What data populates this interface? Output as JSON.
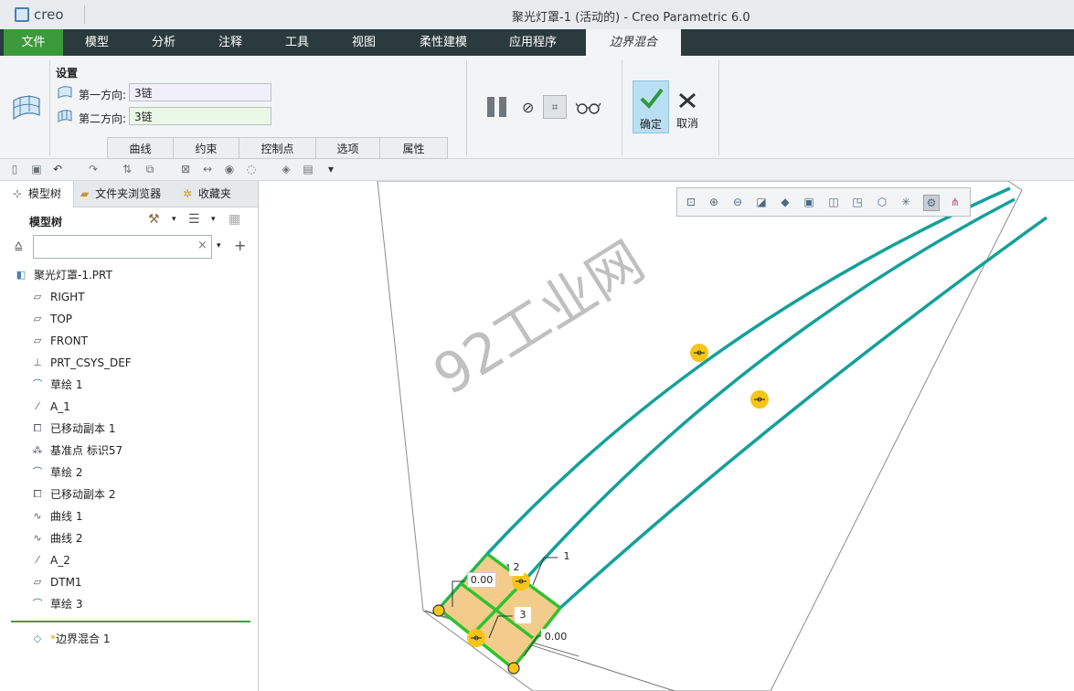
{
  "window": {
    "app_name": "creo",
    "title": "聚光灯罩-1 (活动的) - Creo Parametric 6.0"
  },
  "menu": {
    "file": "文件",
    "tabs": [
      "模型",
      "分析",
      "注释",
      "工具",
      "视图",
      "柔性建模",
      "应用程序"
    ],
    "active_tab": "边界混合"
  },
  "ribbon": {
    "settings_label": "设置",
    "first_direction_label": "第一方向:",
    "first_direction_value": "3链",
    "second_direction_label": "第二方向:",
    "second_direction_value": "3链",
    "subtabs": [
      "曲线",
      "约束",
      "控制点",
      "选项",
      "属性"
    ],
    "ok_label": "确定",
    "cancel_label": "取消",
    "colors": {
      "first_input_bg": "#f1effc",
      "second_input_bg": "#eaf8e6",
      "ok_bg": "#b9dff2"
    }
  },
  "nav": {
    "tabs": [
      "模型树",
      "文件夹浏览器",
      "收藏夹"
    ],
    "header": "模型树",
    "search_placeholder": "",
    "root": "聚光灯罩-1.PRT",
    "items": [
      {
        "label": "RIGHT",
        "icon": "datum-plane-icon"
      },
      {
        "label": "TOP",
        "icon": "datum-plane-icon"
      },
      {
        "label": "FRONT",
        "icon": "datum-plane-icon"
      },
      {
        "label": "PRT_CSYS_DEF",
        "icon": "csys-icon"
      },
      {
        "label": "草绘 1",
        "icon": "sketch-icon"
      },
      {
        "label": "A_1",
        "icon": "axis-icon"
      },
      {
        "label": "已移动副本 1",
        "icon": "moved-copy-icon"
      },
      {
        "label": "基准点 标识57",
        "icon": "datum-point-icon"
      },
      {
        "label": "草绘 2",
        "icon": "sketch-icon"
      },
      {
        "label": "已移动副本 2",
        "icon": "moved-copy-icon"
      },
      {
        "label": "曲线 1",
        "icon": "curve-icon"
      },
      {
        "label": "曲线 2",
        "icon": "curve-icon"
      },
      {
        "label": "A_2",
        "icon": "axis-icon"
      },
      {
        "label": "DTM1",
        "icon": "datum-plane-icon"
      },
      {
        "label": "草绘 3",
        "icon": "sketch-icon"
      }
    ],
    "insert_item": "边界混合 1"
  },
  "viewport": {
    "watermark": "92工业网",
    "labels": {
      "label_1": "1",
      "label_2": "2",
      "label_3": "3",
      "dim_a": "0.00",
      "dim_b": "0.00"
    },
    "colors": {
      "curve": "#14a09a",
      "boundary": "#2fc22f",
      "surface": "#f3cc8c",
      "handle": "#f5c518"
    }
  }
}
